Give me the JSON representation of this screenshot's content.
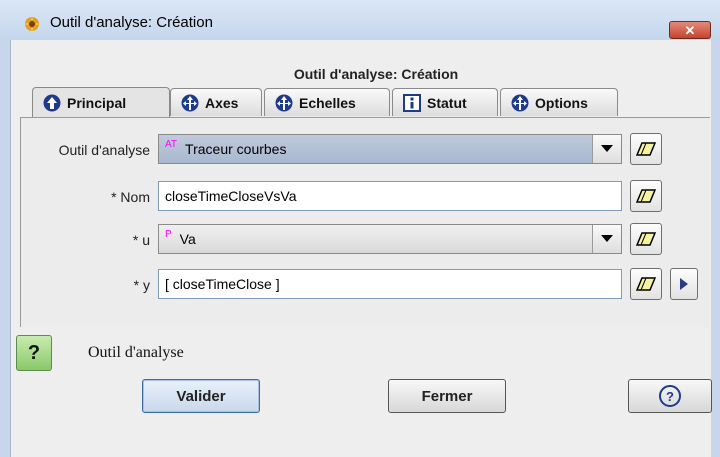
{
  "window": {
    "title": "Outil d'analyse: Création",
    "close_label": "✕"
  },
  "dialog": {
    "heading": "Outil d'analyse: Création"
  },
  "tabs": [
    {
      "label": "Principal",
      "icon": "up-arrow-circle-icon"
    },
    {
      "label": "Axes",
      "icon": "axes-arrows-icon"
    },
    {
      "label": "Echelles",
      "icon": "scales-arrows-icon"
    },
    {
      "label": "Statut",
      "icon": "info-icon"
    },
    {
      "label": "Options",
      "icon": "options-arrows-icon"
    }
  ],
  "form": {
    "tool": {
      "label": "Outil d'analyse",
      "tag": "AT",
      "value": "Traceur courbes"
    },
    "name": {
      "label": "* Nom",
      "value": "closeTimeCloseVsVa"
    },
    "u": {
      "label": "* u",
      "tag": "P",
      "value": "Va"
    },
    "y": {
      "label": "* y",
      "value": "[ closeTimeClose ]"
    }
  },
  "help": {
    "icon_label": "?",
    "text": "Outil d'analyse"
  },
  "buttons": {
    "validate": "Valider",
    "close": "Fermer",
    "help": "?"
  },
  "colors": {
    "title_bg": "#c5d6ec",
    "close_btn": "#c44430",
    "tag": "#ff00ff",
    "tab_icon": "#1e3a8a",
    "help_green": "#8ac86a"
  }
}
